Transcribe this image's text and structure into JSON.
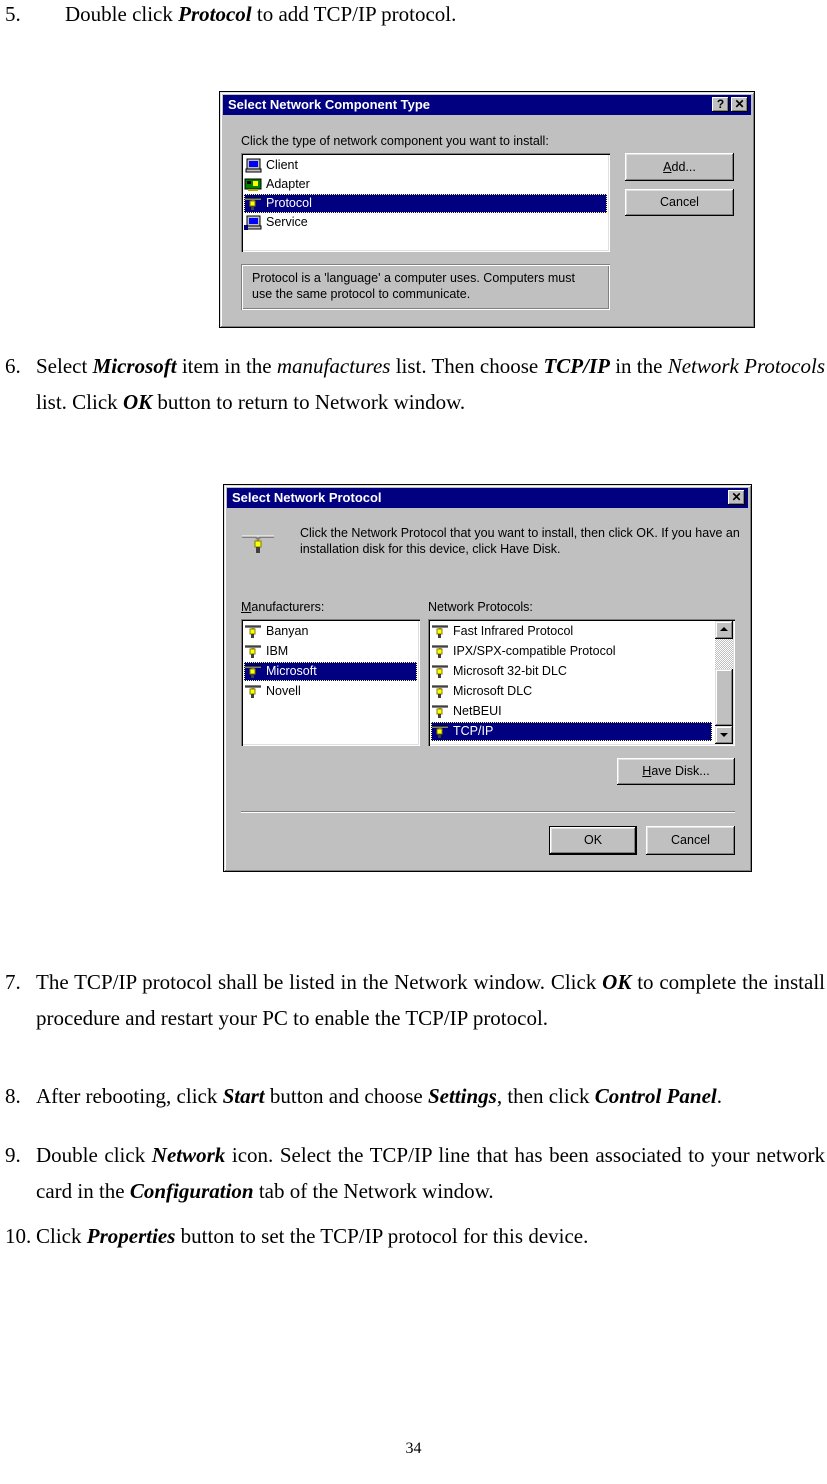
{
  "steps": [
    {
      "num": "5.",
      "parts": [
        {
          "t": "Double click "
        },
        {
          "t": "Protocol",
          "s": "bi"
        },
        {
          "t": " to add TCP/IP protocol."
        }
      ]
    },
    {
      "num": "6.",
      "parts": [
        {
          "t": "Select "
        },
        {
          "t": "Microsoft",
          "s": "bi"
        },
        {
          "t": " item in the "
        },
        {
          "t": "manufactures",
          "s": "it"
        },
        {
          "t": " list. Then choose "
        },
        {
          "t": "TCP/IP",
          "s": "bi"
        },
        {
          "t": " in the "
        },
        {
          "t": "Network Protocols",
          "s": "it"
        },
        {
          "t": " list. Click "
        },
        {
          "t": "OK",
          "s": "bi"
        },
        {
          "t": " button to return to Network window."
        }
      ]
    },
    {
      "num": "7.",
      "parts": [
        {
          "t": "The TCP/IP protocol shall be listed in the Network window. Click "
        },
        {
          "t": "OK",
          "s": "bi"
        },
        {
          "t": " to complete the install procedure and restart your PC to enable the TCP/IP protocol."
        }
      ]
    },
    {
      "num": "8.",
      "parts": [
        {
          "t": "After rebooting, click "
        },
        {
          "t": "Start",
          "s": "bi"
        },
        {
          "t": " button and choose "
        },
        {
          "t": "Settings",
          "s": "bi"
        },
        {
          "t": ", then click "
        },
        {
          "t": "Control Panel",
          "s": "bi"
        },
        {
          "t": "."
        }
      ]
    },
    {
      "num": "9.",
      "parts": [
        {
          "t": "Double click "
        },
        {
          "t": "Network",
          "s": "bi"
        },
        {
          "t": " icon. Select the TCP/IP line that has been associated to your network card in the "
        },
        {
          "t": "Configuration",
          "s": "bi"
        },
        {
          "t": " tab of the Network window."
        }
      ]
    },
    {
      "num": "10.",
      "parts": [
        {
          "t": "Click "
        },
        {
          "t": "Properties",
          "s": "bi"
        },
        {
          "t": " button to set the TCP/IP protocol for this device."
        }
      ]
    }
  ],
  "dialog1": {
    "title": "Select Network Component Type",
    "help_glyph": "?",
    "close_glyph": "✕",
    "prompt": "Click the type of network component you want to install:",
    "items": [
      {
        "label": "Client",
        "icon": "client-computer-icon",
        "selected": false
      },
      {
        "label": "Adapter",
        "icon": "adapter-card-icon",
        "selected": false
      },
      {
        "label": "Protocol",
        "icon": "protocol-network-icon",
        "selected": true
      },
      {
        "label": "Service",
        "icon": "service-computer-icon",
        "selected": false
      }
    ],
    "add_button": {
      "accel": "A",
      "rest": "dd..."
    },
    "cancel_button": "Cancel",
    "description": "Protocol is a 'language' a computer uses. Computers must use the same protocol to communicate."
  },
  "dialog2": {
    "title": "Select Network Protocol",
    "close_glyph": "✕",
    "instructions": "Click the Network Protocol that you want to install, then click OK. If you have an installation disk for this device, click Have Disk.",
    "manufacturers_label": {
      "accel": "M",
      "rest": "anufacturers:"
    },
    "protocols_label": "Network Protocols:",
    "manufacturers": [
      {
        "label": "Banyan",
        "selected": false
      },
      {
        "label": "IBM",
        "selected": false
      },
      {
        "label": "Microsoft",
        "selected": true
      },
      {
        "label": "Novell",
        "selected": false
      }
    ],
    "protocols": [
      {
        "label": "Fast Infrared Protocol",
        "selected": false
      },
      {
        "label": "IPX/SPX-compatible Protocol",
        "selected": false
      },
      {
        "label": "Microsoft 32-bit DLC",
        "selected": false
      },
      {
        "label": "Microsoft DLC",
        "selected": false
      },
      {
        "label": "NetBEUI",
        "selected": false
      },
      {
        "label": "TCP/IP",
        "selected": true
      }
    ],
    "have_disk_button": {
      "accel": "H",
      "rest": "ave Disk..."
    },
    "ok_button": "OK",
    "cancel_button": "Cancel"
  },
  "page_number": "34"
}
